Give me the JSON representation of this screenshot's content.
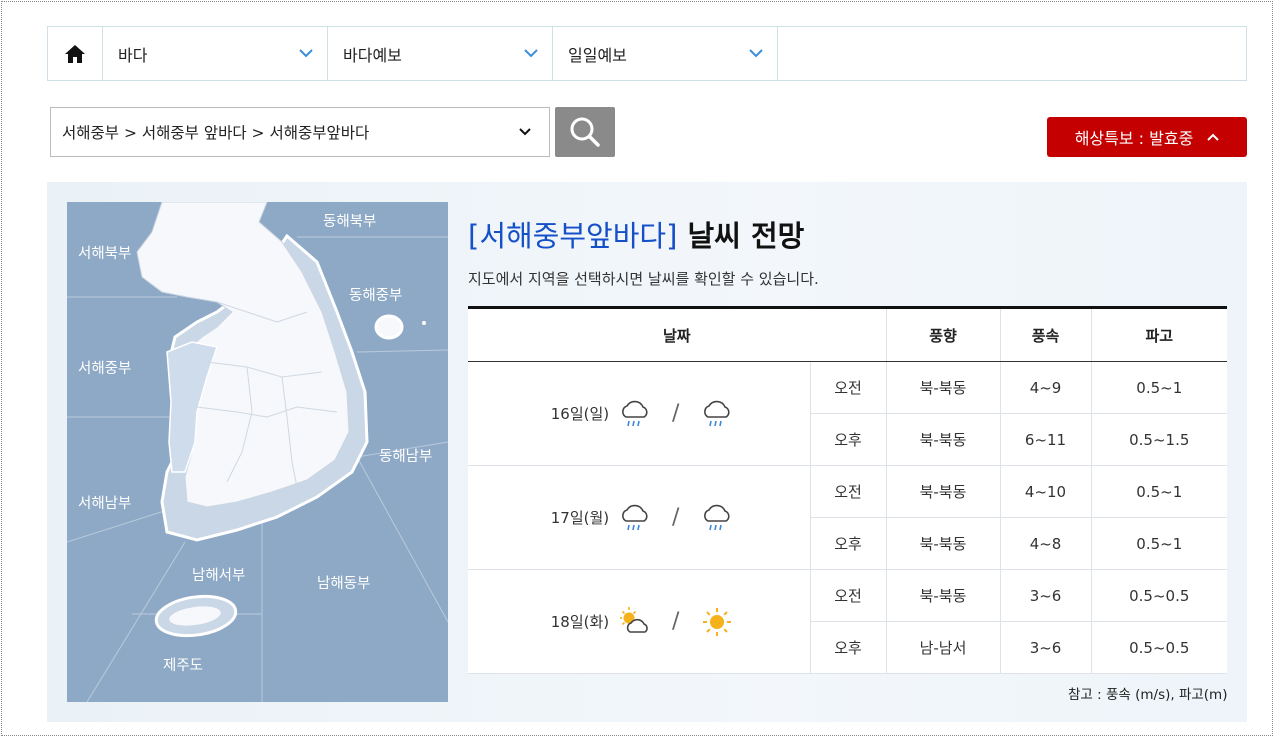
{
  "nav": {
    "dropdowns": [
      {
        "label": "바다"
      },
      {
        "label": "바다예보"
      },
      {
        "label": "일일예보"
      }
    ]
  },
  "search": {
    "location": "서해중부 > 서해중부 앞바다 > 서해중부앞바다"
  },
  "warning_button": {
    "label": "해상특보 : 발효중"
  },
  "map": {
    "regions": [
      "서해북부",
      "동해북부",
      "동해중부",
      "서해중부",
      "동해남부",
      "서해남부",
      "남해서부",
      "남해동부",
      "제주도"
    ]
  },
  "forecast": {
    "title_highlight": "[서해중부앞바다]",
    "title_rest": " 날씨 전망",
    "subtitle": "지도에서 지역을 선택하시면 날씨를 확인할 수 있습니다.",
    "headers": {
      "date": "날짜",
      "wind_dir": "풍향",
      "wind_speed": "풍속",
      "wave": "파고"
    },
    "separator": "/",
    "days": [
      {
        "date": "16일(일)",
        "am_icon": "rain-cloud-icon",
        "pm_icon": "rain-cloud-icon",
        "rows": [
          {
            "period": "오전",
            "dir": "북-북동",
            "speed": "4~9",
            "wave": "0.5~1"
          },
          {
            "period": "오후",
            "dir": "북-북동",
            "speed": "6~11",
            "wave": "0.5~1.5"
          }
        ]
      },
      {
        "date": "17일(월)",
        "am_icon": "rain-cloud-icon",
        "pm_icon": "rain-cloud-icon",
        "rows": [
          {
            "period": "오전",
            "dir": "북-북동",
            "speed": "4~10",
            "wave": "0.5~1"
          },
          {
            "period": "오후",
            "dir": "북-북동",
            "speed": "4~8",
            "wave": "0.5~1"
          }
        ]
      },
      {
        "date": "18일(화)",
        "am_icon": "sun-cloud-icon",
        "pm_icon": "sun-icon",
        "rows": [
          {
            "period": "오전",
            "dir": "북-북동",
            "speed": "3~6",
            "wave": "0.5~0.5"
          },
          {
            "period": "오후",
            "dir": "남-남서",
            "speed": "3~6",
            "wave": "0.5~0.5"
          }
        ]
      }
    ],
    "note": "참고 : 풍속 (m/s), 파고(m)"
  },
  "colors": {
    "accent": "#1550c9",
    "warning": "#c40000",
    "map_sea": "#8ea9c6",
    "search_button": "#8a8a8a"
  }
}
